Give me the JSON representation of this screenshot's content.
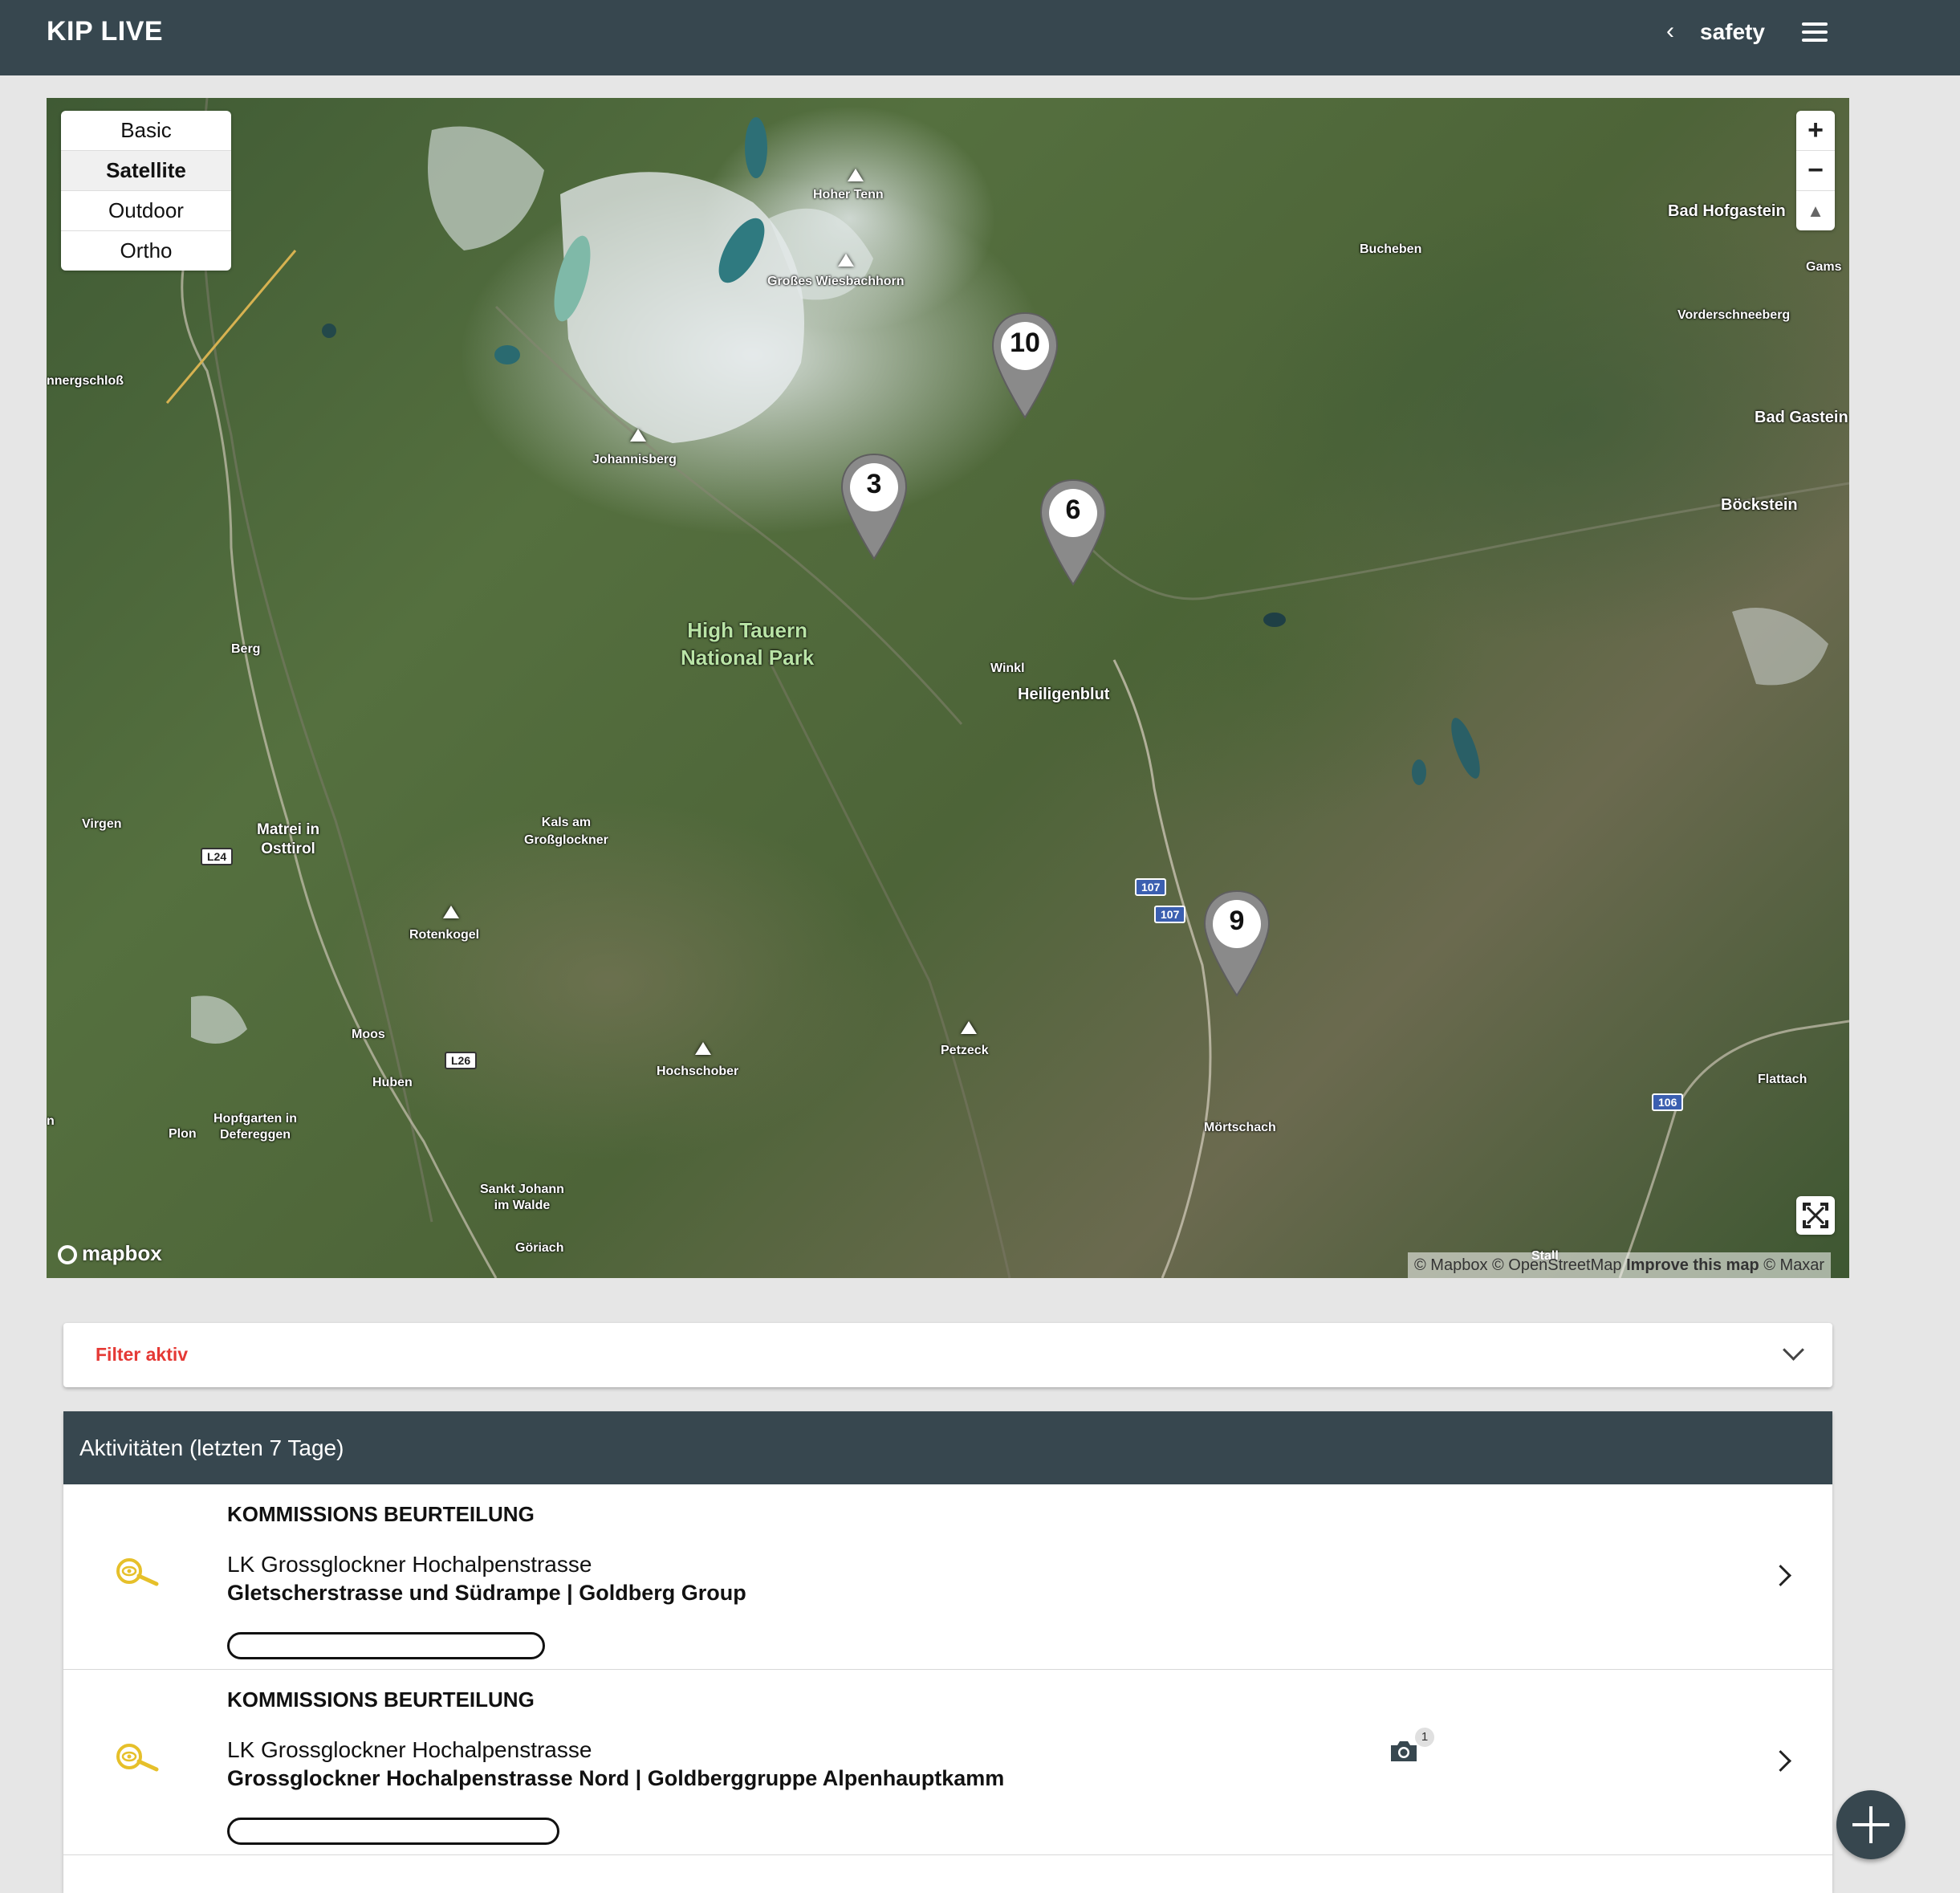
{
  "app": {
    "title": "KIP LIVE",
    "section": "safety"
  },
  "map": {
    "styles": [
      {
        "label": "Basic",
        "active": false
      },
      {
        "label": "Satellite",
        "active": true
      },
      {
        "label": "Outdoor",
        "active": false
      },
      {
        "label": "Ortho",
        "active": false
      }
    ],
    "zoom_in": "+",
    "zoom_out": "−",
    "compass": "▲",
    "park_label": "High Tauern\nNational Park",
    "places": {
      "hoher_tenn": "Hoher Tenn",
      "gross_wiesbachhorn": "Großes Wiesbachhorn",
      "johannisberg": "Johannisberg",
      "bucheben": "Bucheben",
      "bad_hofgastein": "Bad Hofgastein",
      "gams": "Gams",
      "vorderschneeberg": "Vorderschneeberg",
      "bad_gastein": "Bad Gastein",
      "boeckstein": "Böckstein",
      "winkl": "Winkl",
      "heiligenblut": "Heiligenblut",
      "berg": "Berg",
      "nnergschloss": "nnergschloß",
      "virgen": "Virgen",
      "matrei": "Matrei in\nOsttirol",
      "kals": "Kals am\nGroßglockner",
      "rotenkogel": "Rotenkogel",
      "moos": "Moos",
      "huben": "Huben",
      "hochschober": "Hochschober",
      "petzeck": "Petzeck",
      "moertschach": "Mörtschach",
      "flattach": "Flattach",
      "plon": "Plon",
      "hopfgarten": "Hopfgarten in\nDefereggen",
      "sankt_johann": "Sankt Johann\nim Walde",
      "goeriach": "Göriach",
      "stall": "Stall",
      "edge_n": "n"
    },
    "roads": {
      "l24": "L24",
      "l26": "L26",
      "r107a": "107",
      "r107b": "107",
      "r106": "106"
    },
    "markers": [
      {
        "count": "10"
      },
      {
        "count": "3"
      },
      {
        "count": "6"
      },
      {
        "count": "9"
      }
    ],
    "logo": "mapbox",
    "attribution": {
      "mapbox": "© Mapbox",
      "osm": "© OpenStreetMap",
      "improve": "Improve this map",
      "maxar": "© Maxar"
    }
  },
  "filter": {
    "label": "Filter aktiv"
  },
  "activities": {
    "title": "Aktivitäten (letzten 7 Tage)",
    "items": [
      {
        "type": "KOMMISSIONS BEURTEILUNG",
        "line1": "LK Grossglockner Hochalpenstrasse",
        "line2": "Gletscherstrasse und Südrampe | Goldberg Group",
        "photos": ""
      },
      {
        "type": "KOMMISSIONS BEURTEILUNG",
        "line1": "LK Grossglockner Hochalpenstrasse",
        "line2": "Grossglockner Hochalpenstrasse Nord | Goldberggruppe Alpenhauptkamm",
        "photos": "1"
      }
    ]
  },
  "colors": {
    "header": "#37474f",
    "filter_active": "#e53935",
    "icon_yellow": "#e6c02a"
  },
  "icons": {
    "back": "chevron-left-icon",
    "menu": "hamburger-menu-icon",
    "activity": "magnifier-eye-icon",
    "camera": "camera-icon",
    "fab": "plus-icon"
  }
}
